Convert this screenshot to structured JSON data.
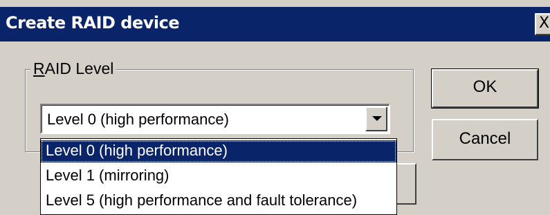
{
  "window": {
    "title": "Create RAID device",
    "close_label": "X"
  },
  "raid_group": {
    "label_accel": "R",
    "label_rest": "AID Level",
    "selected_value": "Level 0 (high performance)",
    "options": [
      "Level 0 (high performance)",
      "Level 1 (mirroring)",
      "Level 5 (high performance and fault tolerance)"
    ],
    "highlighted_index": 0
  },
  "buttons": {
    "ok": "OK",
    "cancel": "Cancel"
  },
  "colors": {
    "titlebar": "#0a246a",
    "face": "#d4d0c8",
    "highlight": "#0a246a"
  }
}
